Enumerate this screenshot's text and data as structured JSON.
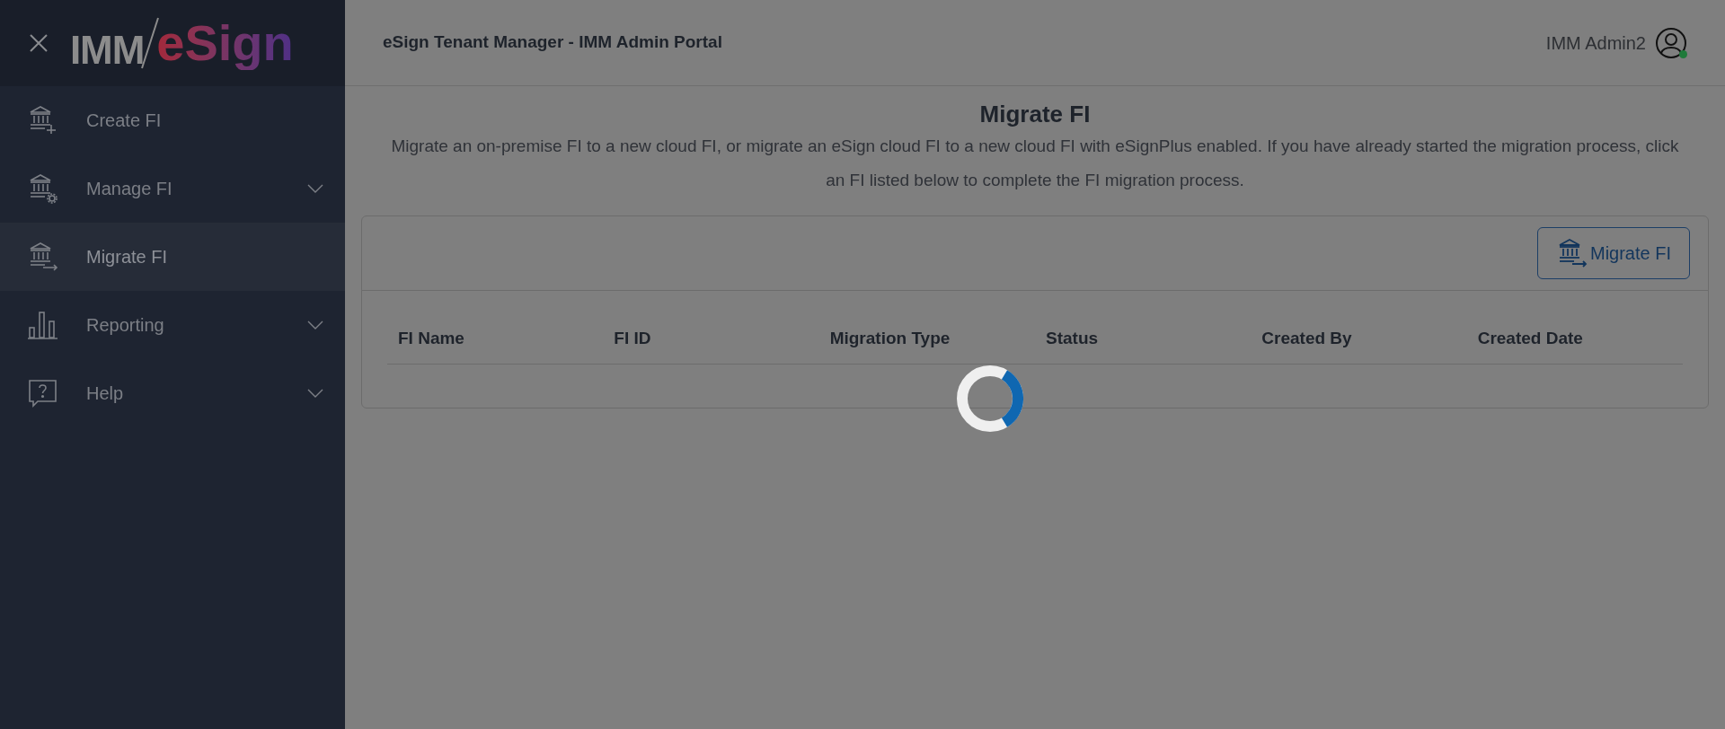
{
  "sidebar": {
    "logo": {
      "brand": "IMM",
      "product": "eSign"
    },
    "items": [
      {
        "kind": "create",
        "label": "Create FI",
        "selected": false,
        "expandable": false
      },
      {
        "kind": "manage",
        "label": "Manage FI",
        "selected": false,
        "expandable": true
      },
      {
        "kind": "migrate",
        "label": "Migrate FI",
        "selected": true,
        "expandable": false
      },
      {
        "kind": "reporting",
        "label": "Reporting",
        "selected": false,
        "expandable": true
      },
      {
        "kind": "help",
        "label": "Help",
        "selected": false,
        "expandable": true
      }
    ]
  },
  "header": {
    "title": "eSign Tenant Manager - IMM Admin Portal",
    "user": "IMM Admin2",
    "online": true
  },
  "page": {
    "title": "Migrate FI",
    "description": "Migrate an on-premise FI to a new cloud FI, or migrate an eSign cloud FI to a new cloud FI with eSignPlus enabled. If you have already started the migration process, click an FI listed below to complete the FI migration process.",
    "action": "Migrate FI",
    "table": {
      "columns": [
        "FI Name",
        "FI ID",
        "Migration Type",
        "Status",
        "Created By",
        "Created Date"
      ]
    },
    "loading": true
  }
}
